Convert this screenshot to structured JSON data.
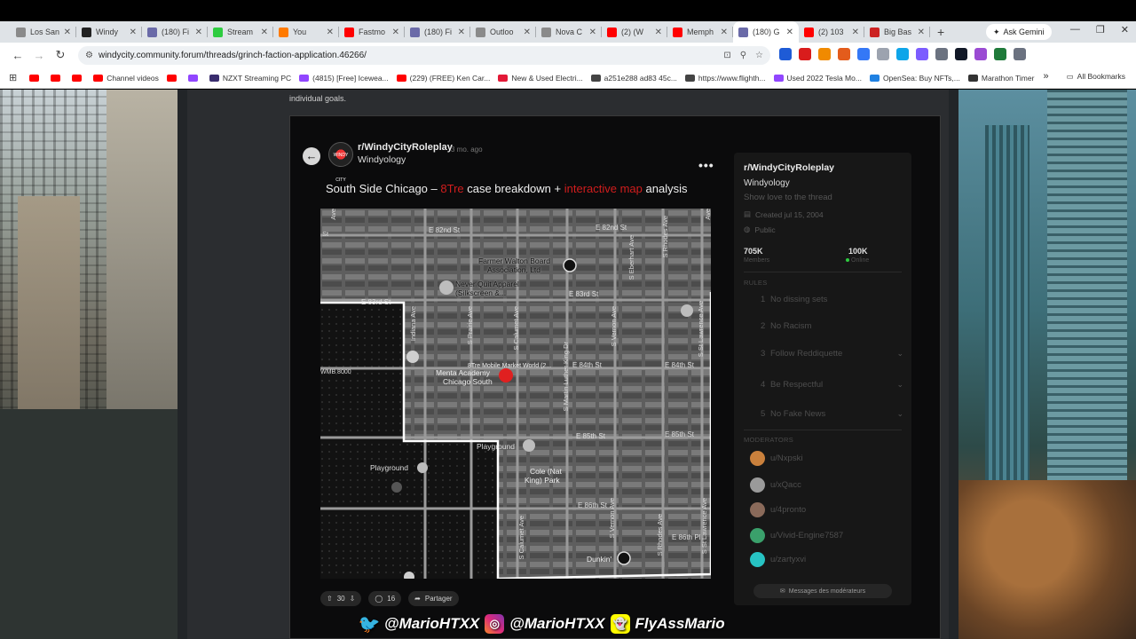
{
  "browser": {
    "tabs": [
      {
        "title": "Los San",
        "color": "#8a8a8a"
      },
      {
        "title": "Windy",
        "color": "#222222"
      },
      {
        "title": "(180) Fi",
        "color": "#6a6aa8"
      },
      {
        "title": "Stream",
        "color": "#2ecc40"
      },
      {
        "title": "You",
        "color": "#ff7a00"
      },
      {
        "title": "Fastmo",
        "color": "#ff0000"
      },
      {
        "title": "(180) Fi",
        "color": "#6a6aa8"
      },
      {
        "title": "Outloo",
        "color": "#8a8a8a"
      },
      {
        "title": "Nova C",
        "color": "#8a8a8a"
      },
      {
        "title": "(2) (W",
        "color": "#ff0000"
      },
      {
        "title": "Memph",
        "color": "#ff0000"
      },
      {
        "title": "(180) G",
        "color": "#6a6aa8",
        "active": true
      },
      {
        "title": "(2) 103",
        "color": "#ff0000"
      },
      {
        "title": "Big Bas",
        "color": "#cc2222"
      }
    ],
    "new_tab": "+",
    "ask_gemini": "Ask Gemini",
    "window_controls": [
      "—",
      "❐",
      "✕"
    ],
    "url": "windycity.community.forum/threads/grinch-faction-application.46266/",
    "extension_colors": [
      "#1e5bd6",
      "#d91c1c",
      "#f08a00",
      "#e35c1c",
      "#3478f6",
      "#9ca3af",
      "#0ea5e9",
      "#7c5cff",
      "#6b7280",
      "#111827",
      "#9a4bd3",
      "#1f7a3a",
      "#6b7280"
    ],
    "bookmarks": [
      {
        "label": "",
        "color": "#ff0000"
      },
      {
        "label": "",
        "color": "#ff0000"
      },
      {
        "label": "",
        "color": "#ff0000"
      },
      {
        "label": "Channel videos",
        "color": "#ff0000"
      },
      {
        "label": "",
        "color": "#ff0000"
      },
      {
        "label": "",
        "color": "#9146ff"
      },
      {
        "label": "NZXT Streaming PC",
        "color": "#3a2d6e"
      },
      {
        "label": "(4815) [Free] Icewea...",
        "color": "#9146ff"
      },
      {
        "label": "(229) (FREE) Ken Car...",
        "color": "#ff0000"
      },
      {
        "label": "New & Used Electri...",
        "color": "#e31937"
      },
      {
        "label": "a251e288 ad83 45c...",
        "color": "#444444"
      },
      {
        "label": "https://www.flighth...",
        "color": "#444444"
      },
      {
        "label": "Used 2022 Tesla Mo...",
        "color": "#9146ff"
      },
      {
        "label": "OpenSea: Buy NFTs,...",
        "color": "#2081e2"
      },
      {
        "label": "Marathon Timer",
        "color": "#333333"
      }
    ],
    "bookmarks_more": "»",
    "all_bookmarks": "All Bookmarks"
  },
  "page": {
    "intro_text": "individual goals.",
    "post": {
      "subreddit": "r/WindyCityRoleplay",
      "age": "3 mo. ago",
      "user": "Windyology",
      "avatar_text": "WINDY CITY",
      "title_parts": [
        "South Side Chicago – ",
        "8Tre",
        " case breakdown + ",
        "interactive map",
        " analysis"
      ],
      "votes": "30",
      "comments": "16",
      "share": "Partager"
    },
    "map_labels": {
      "streets": [
        "E 82nd St",
        "E 82nd St",
        "E 83rd St",
        "E 83rd St",
        "E 84th St",
        "E 84th St",
        "E 85th St",
        "E 85th St",
        "E 86th St",
        "E 86th Pl",
        "Indiana Ave",
        "S Prairie Ave",
        "S Calumet Ave",
        "S Martin Luther King Dr",
        "S Vernon Ave",
        "S Eberhart Ave",
        "S Rhodes Ave",
        "S St Lawrence Ave",
        "S Calumet Ave",
        "S Vernon Ave",
        "S Rhodes Ave",
        "S St Lawrence Ave",
        "St",
        "Ave",
        "Ave"
      ],
      "places": [
        "Never Quit Apparel",
        "(Silkscreen &...",
        "Farmer Walton Board",
        "Association, Ltd",
        "Menta Academy",
        "Chicago South",
        "8Tre Mobile Market World (2...",
        "WMB 8000",
        "Playground",
        "Playground",
        "Cole (Nat",
        "King) Park",
        "Dunkin'"
      ]
    },
    "sidebar": {
      "name": "r/WindyCityRoleplay",
      "title": "Windyology",
      "description": "Show love to the thread",
      "created": "Created jul 15, 2004",
      "visibility": "Public",
      "members_num": "705K",
      "members_lbl": "Members",
      "online_num": "100K",
      "online_lbl": "Online",
      "rules_heading": "RULES",
      "rules": [
        {
          "n": "1",
          "text": "No dissing sets"
        },
        {
          "n": "2",
          "text": "No Racism"
        },
        {
          "n": "3",
          "text": "Follow Reddiquette"
        },
        {
          "n": "4",
          "text": "Be Respectful"
        },
        {
          "n": "5",
          "text": "No Fake News"
        }
      ],
      "mods_heading": "MODERATORS",
      "mods": [
        {
          "name": "u/Nxpski",
          "color": "#c9803c"
        },
        {
          "name": "u/xQacc",
          "color": "#9a9a9a"
        },
        {
          "name": "u/4pronto",
          "color": "#8a6a5a"
        },
        {
          "name": "u/Vivid-Engine7587",
          "color": "#3aa06b"
        },
        {
          "name": "u/zartyxvi",
          "color": "#27c3c3"
        }
      ],
      "message_mods": "Messages des modérateurs"
    }
  },
  "watermark": {
    "twitter": "@MarioHTXX",
    "instagram": "@MarioHTXX",
    "snapchat": "FlyAssMario"
  }
}
